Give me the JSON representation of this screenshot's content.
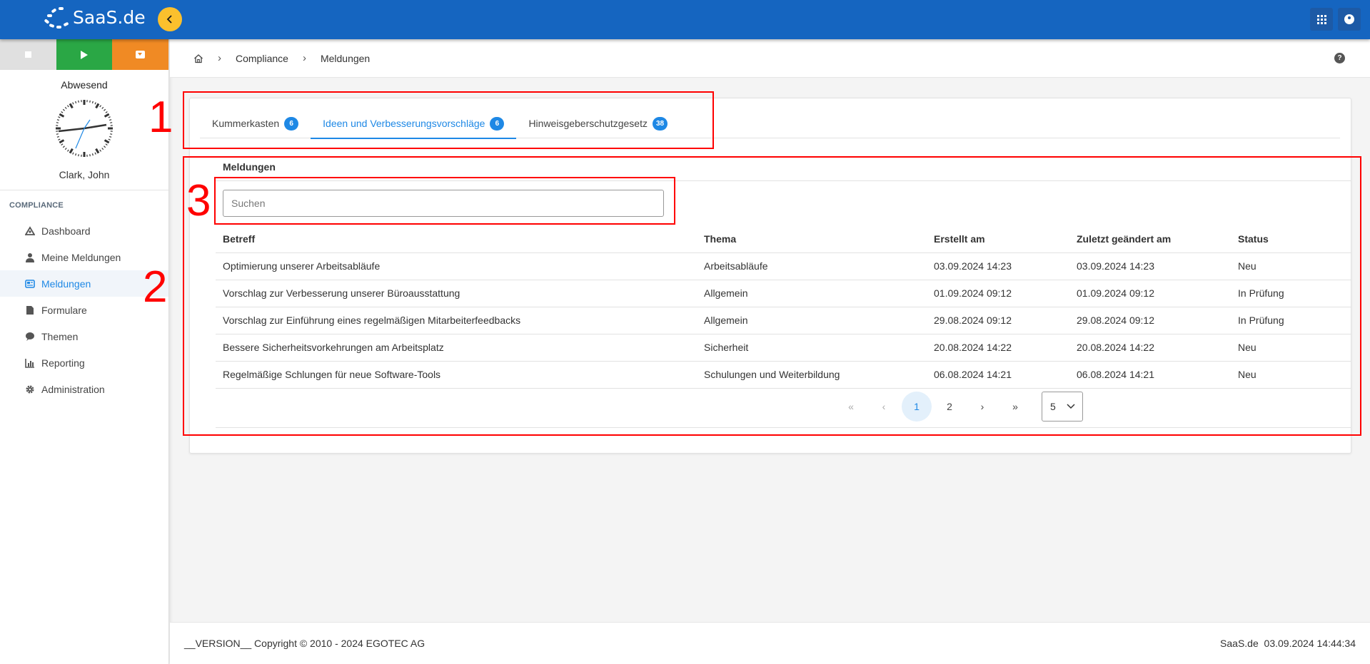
{
  "header": {
    "logo_text": "SaaS.de",
    "collapse_icon": "chevron-left-icon",
    "apps_icon": "grid-icon",
    "account_icon": "user-circle-icon",
    "colors": {
      "primary": "#1565c0",
      "accent": "#fbc02d"
    }
  },
  "sidebar": {
    "time_controls": [
      {
        "icon": "stop-icon",
        "color": "#e0e0e0"
      },
      {
        "icon": "play-icon",
        "color": "#2aa745"
      },
      {
        "icon": "dropdown-icon",
        "color": "#f08a24"
      }
    ],
    "status": "Abwesend",
    "user_name": "Clark, John",
    "section_title": "COMPLIANCE",
    "items": [
      {
        "label": "Dashboard",
        "icon": "dashboard-icon",
        "active": false
      },
      {
        "label": "Meine Meldungen",
        "icon": "person-icon",
        "active": false
      },
      {
        "label": "Meldungen",
        "icon": "newspaper-icon",
        "active": true
      },
      {
        "label": "Formulare",
        "icon": "file-icon",
        "active": false
      },
      {
        "label": "Themen",
        "icon": "comment-icon",
        "active": false
      },
      {
        "label": "Reporting",
        "icon": "chart-icon",
        "active": false
      },
      {
        "label": "Administration",
        "icon": "gear-icon",
        "active": false
      }
    ]
  },
  "breadcrumb": {
    "home_icon": "home-icon",
    "items": [
      "Compliance",
      "Meldungen"
    ],
    "help_icon": "help-icon"
  },
  "tabs": [
    {
      "label": "Kummerkasten",
      "count": "6",
      "active": false
    },
    {
      "label": "Ideen und Verbesserungsvorschläge",
      "count": "6",
      "active": true
    },
    {
      "label": "Hinweisgeberschutzgesetz",
      "count": "38",
      "active": false
    }
  ],
  "list": {
    "title": "Meldungen",
    "search_placeholder": "Suchen",
    "columns": [
      "Betreff",
      "Thema",
      "Erstellt am",
      "Zuletzt geändert am",
      "Status"
    ],
    "rows": [
      [
        "Optimierung unserer Arbeitsabläufe",
        "Arbeitsabläufe",
        "03.09.2024 14:23",
        "03.09.2024 14:23",
        "Neu"
      ],
      [
        "Vorschlag zur Verbesserung unserer Büroausstattung",
        "Allgemein",
        "01.09.2024 09:12",
        "01.09.2024 09:12",
        "In Prüfung"
      ],
      [
        "Vorschlag zur Einführung eines regelmäßigen Mitarbeiterfeedbacks",
        "Allgemein",
        "29.08.2024 09:12",
        "29.08.2024 09:12",
        "In Prüfung"
      ],
      [
        "Bessere Sicherheitsvorkehrungen am Arbeitsplatz",
        "Sicherheit",
        "20.08.2024 14:22",
        "20.08.2024 14:22",
        "Neu"
      ],
      [
        "Regelmäßige Schlungen für neue Software-Tools",
        "Schulungen und Weiterbildung",
        "06.08.2024 14:21",
        "06.08.2024 14:21",
        "Neu"
      ]
    ]
  },
  "pagination": {
    "first": "«",
    "prev": "‹",
    "pages": [
      "1",
      "2"
    ],
    "current": "1",
    "next": "›",
    "last": "»",
    "page_size": "5"
  },
  "footer": {
    "left": "__VERSION__ Copyright © 2010 - 2024 EGOTEC AG",
    "right": "SaaS.de  03.09.2024 14:44:34"
  },
  "annotations": [
    "1",
    "2",
    "3"
  ]
}
